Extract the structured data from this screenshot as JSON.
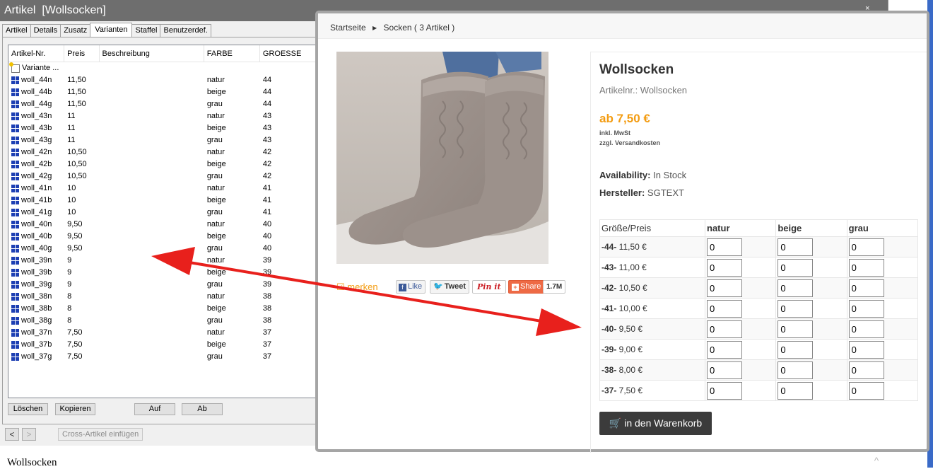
{
  "window": {
    "title": "Artikel  [Wollsocken]",
    "close_glyph": "×",
    "tabs": [
      "Artikel",
      "Details",
      "Zusatz",
      "Varianten",
      "Staffel",
      "Benutzerdef."
    ],
    "active_tab": 3
  },
  "list": {
    "headers": [
      "Artikel-Nr.",
      "Preis",
      "Beschreibung",
      "FARBE",
      "GROESSE"
    ],
    "new_row_label": "Variante ...",
    "rows": [
      {
        "nr": "woll_44n",
        "preis": "11,50",
        "farbe": "natur",
        "groesse": "44"
      },
      {
        "nr": "woll_44b",
        "preis": "11,50",
        "farbe": "beige",
        "groesse": "44"
      },
      {
        "nr": "woll_44g",
        "preis": "11,50",
        "farbe": "grau",
        "groesse": "44"
      },
      {
        "nr": "woll_43n",
        "preis": "11",
        "farbe": "natur",
        "groesse": "43"
      },
      {
        "nr": "woll_43b",
        "preis": "11",
        "farbe": "beige",
        "groesse": "43"
      },
      {
        "nr": "woll_43g",
        "preis": "11",
        "farbe": "grau",
        "groesse": "43"
      },
      {
        "nr": "woll_42n",
        "preis": "10,50",
        "farbe": "natur",
        "groesse": "42"
      },
      {
        "nr": "woll_42b",
        "preis": "10,50",
        "farbe": "beige",
        "groesse": "42"
      },
      {
        "nr": "woll_42g",
        "preis": "10,50",
        "farbe": "grau",
        "groesse": "42"
      },
      {
        "nr": "woll_41n",
        "preis": "10",
        "farbe": "natur",
        "groesse": "41"
      },
      {
        "nr": "woll_41b",
        "preis": "10",
        "farbe": "beige",
        "groesse": "41"
      },
      {
        "nr": "woll_41g",
        "preis": "10",
        "farbe": "grau",
        "groesse": "41"
      },
      {
        "nr": "woll_40n",
        "preis": "9,50",
        "farbe": "natur",
        "groesse": "40"
      },
      {
        "nr": "woll_40b",
        "preis": "9,50",
        "farbe": "beige",
        "groesse": "40"
      },
      {
        "nr": "woll_40g",
        "preis": "9,50",
        "farbe": "grau",
        "groesse": "40"
      },
      {
        "nr": "woll_39n",
        "preis": "9",
        "farbe": "natur",
        "groesse": "39"
      },
      {
        "nr": "woll_39b",
        "preis": "9",
        "farbe": "beige",
        "groesse": "39"
      },
      {
        "nr": "woll_39g",
        "preis": "9",
        "farbe": "grau",
        "groesse": "39"
      },
      {
        "nr": "woll_38n",
        "preis": "8",
        "farbe": "natur",
        "groesse": "38"
      },
      {
        "nr": "woll_38b",
        "preis": "8",
        "farbe": "beige",
        "groesse": "38"
      },
      {
        "nr": "woll_38g",
        "preis": "8",
        "farbe": "grau",
        "groesse": "38"
      },
      {
        "nr": "woll_37n",
        "preis": "7,50",
        "farbe": "natur",
        "groesse": "37"
      },
      {
        "nr": "woll_37b",
        "preis": "7,50",
        "farbe": "beige",
        "groesse": "37"
      },
      {
        "nr": "woll_37g",
        "preis": "7,50",
        "farbe": "grau",
        "groesse": "37"
      }
    ]
  },
  "buttons": {
    "loeschen": "Löschen",
    "kopieren": "Kopieren",
    "auf": "Auf",
    "ab": "Ab",
    "prev": "<",
    "next": ">",
    "cross": "Cross-Artikel einfügen"
  },
  "bottom_text": "Wollsocken",
  "bottom_scroll_glyph": "^",
  "shop": {
    "breadcrumb": {
      "home": "Startseite",
      "sep": "▶",
      "category": "Socken ( 3 Artikel )"
    },
    "title": "Wollsocken",
    "artnr": "Artikelnr.: Wollsocken",
    "price": "ab 7,50 €",
    "tax": "inkl. MwSt",
    "shipping": "zzgl. Versandkosten",
    "availability_label": "Availability:",
    "availability_value": " In Stock",
    "manufacturer_label": "Hersteller:",
    "manufacturer_value": " SGTEXT",
    "social": {
      "merken": "☑ merken",
      "like": "Like",
      "fb_glyph": "f",
      "tweet": "Tweet",
      "tw_glyph": "🐦",
      "pin": "Pin it",
      "share": "Share",
      "share_glyph": "+",
      "count": "1.7M"
    },
    "table": {
      "header": [
        "Größe/Preis",
        "natur",
        "beige",
        "grau"
      ],
      "rows": [
        {
          "size": "-44-",
          "price": " 11,50 €",
          "qty": [
            "0",
            "0",
            "0"
          ]
        },
        {
          "size": "-43-",
          "price": " 11,00 €",
          "qty": [
            "0",
            "0",
            "0"
          ]
        },
        {
          "size": "-42-",
          "price": " 10,50 €",
          "qty": [
            "0",
            "0",
            "0"
          ]
        },
        {
          "size": "-41-",
          "price": " 10,00 €",
          "qty": [
            "0",
            "0",
            "0"
          ]
        },
        {
          "size": "-40-",
          "price": " 9,50 €",
          "qty": [
            "0",
            "0",
            "0"
          ]
        },
        {
          "size": "-39-",
          "price": " 9,00 €",
          "qty": [
            "0",
            "0",
            "0"
          ]
        },
        {
          "size": "-38-",
          "price": " 8,00 €",
          "qty": [
            "0",
            "0",
            "0"
          ]
        },
        {
          "size": "-37-",
          "price": " 7,50 €",
          "qty": [
            "0",
            "0",
            "0"
          ]
        }
      ]
    },
    "cart_glyph": "🛒",
    "cart_button": "in den Warenkorb"
  },
  "colors": {
    "accent_orange": "#f39c12",
    "annotation_arrow": "#e8201c",
    "list_icon": "#1d3fb3",
    "cart_button": "#3b3b3b"
  }
}
